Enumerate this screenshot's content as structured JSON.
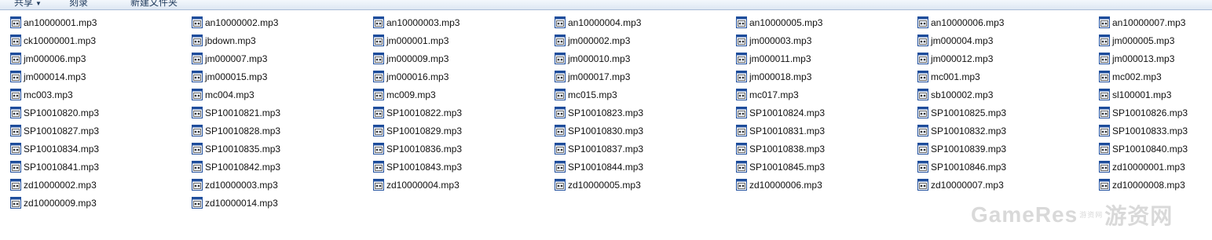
{
  "toolbar": {
    "buttons": [
      "共享",
      "刻录",
      "新建文件夹"
    ]
  },
  "files": [
    "an10000001.mp3",
    "an10000002.mp3",
    "an10000003.mp3",
    "an10000004.mp3",
    "an10000005.mp3",
    "an10000006.mp3",
    "an10000007.mp3",
    "ck10000001.mp3",
    "jbdown.mp3",
    "jm000001.mp3",
    "jm000002.mp3",
    "jm000003.mp3",
    "jm000004.mp3",
    "jm000005.mp3",
    "jm000006.mp3",
    "jm000007.mp3",
    "jm000009.mp3",
    "jm000010.mp3",
    "jm000011.mp3",
    "jm000012.mp3",
    "jm000013.mp3",
    "jm000014.mp3",
    "jm000015.mp3",
    "jm000016.mp3",
    "jm000017.mp3",
    "jm000018.mp3",
    "mc001.mp3",
    "mc002.mp3",
    "mc003.mp3",
    "mc004.mp3",
    "mc009.mp3",
    "mc015.mp3",
    "mc017.mp3",
    "sb100002.mp3",
    "sl100001.mp3",
    "SP10010820.mp3",
    "SP10010821.mp3",
    "SP10010822.mp3",
    "SP10010823.mp3",
    "SP10010824.mp3",
    "SP10010825.mp3",
    "SP10010826.mp3",
    "SP10010827.mp3",
    "SP10010828.mp3",
    "SP10010829.mp3",
    "SP10010830.mp3",
    "SP10010831.mp3",
    "SP10010832.mp3",
    "SP10010833.mp3",
    "SP10010834.mp3",
    "SP10010835.mp3",
    "SP10010836.mp3",
    "SP10010837.mp3",
    "SP10010838.mp3",
    "SP10010839.mp3",
    "SP10010840.mp3",
    "SP10010841.mp3",
    "SP10010842.mp3",
    "SP10010843.mp3",
    "SP10010844.mp3",
    "SP10010845.mp3",
    "SP10010846.mp3",
    "zd10000001.mp3",
    "zd10000002.mp3",
    "zd10000003.mp3",
    "zd10000004.mp3",
    "zd10000005.mp3",
    "zd10000006.mp3",
    "zd10000007.mp3",
    "zd10000008.mp3",
    "zd10000009.mp3",
    "zd10000014.mp3"
  ],
  "file_icon": "audio-file-icon",
  "colors": {
    "icon_blue": "#1f4e9c",
    "watermark": "#d9d9d9"
  },
  "watermark": {
    "text_left": "GameRes",
    "text_small": "游资网",
    "text_right": "游资网"
  }
}
